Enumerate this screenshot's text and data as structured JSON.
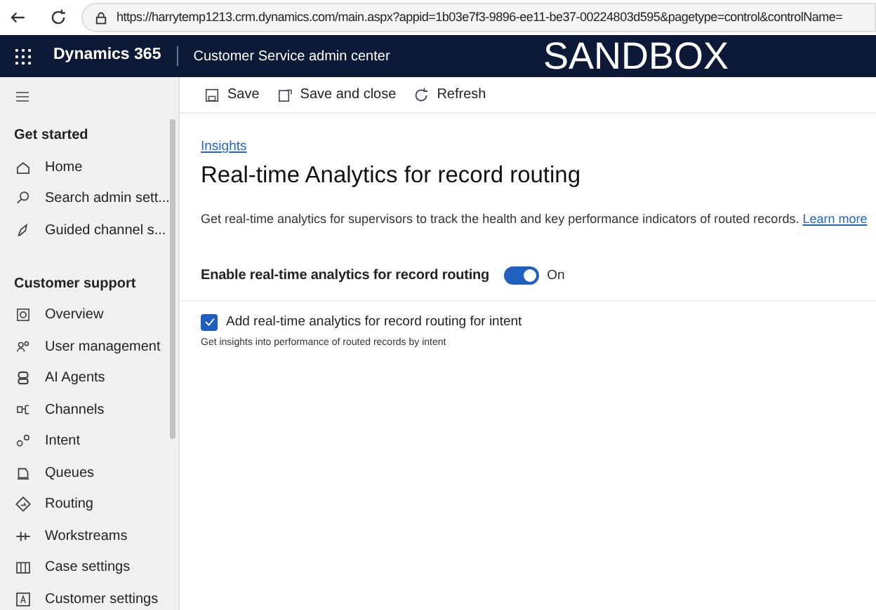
{
  "browser": {
    "url": "https://harrytemp1213.crm.dynamics.com/main.aspx?appid=1b03e7f3-9896-ee11-be37-00224803d595&pagetype=control&controlName="
  },
  "header": {
    "app": "Dynamics 365",
    "area": "Customer Service admin center",
    "banner": "SANDBOX"
  },
  "sidebar": {
    "sections": [
      {
        "title": "Get started",
        "items": [
          {
            "label": "Home",
            "selected": false
          },
          {
            "label": "Search admin sett...",
            "selected": false
          },
          {
            "label": "Guided channel s...",
            "selected": false
          }
        ]
      },
      {
        "title": "Customer support",
        "items": [
          {
            "label": "Overview",
            "selected": false
          },
          {
            "label": "User management",
            "selected": false
          },
          {
            "label": "AI Agents",
            "selected": false
          },
          {
            "label": "Channels",
            "selected": false
          },
          {
            "label": "Intent",
            "selected": false
          },
          {
            "label": "Queues",
            "selected": false
          },
          {
            "label": "Routing",
            "selected": false
          },
          {
            "label": "Workstreams",
            "selected": false
          },
          {
            "label": "Case settings",
            "selected": false
          },
          {
            "label": "Customer settings",
            "selected": false
          }
        ]
      }
    ]
  },
  "commands": [
    "Save",
    "Save and close",
    "Refresh"
  ],
  "breadcrumb": "Insights",
  "title": "Real-time Analytics for record routing",
  "description": {
    "text": "Get real-time analytics for supervisors to track the health and key performance indicators of routed records.",
    "link": "Learn more"
  },
  "toggle": {
    "label": "Enable real-time analytics for record routing",
    "on": true,
    "state": "On"
  },
  "option": {
    "label": "Add real-time analytics for record routing for intent",
    "checked": true,
    "hint": "Get insights into performance of routed records by intent"
  }
}
